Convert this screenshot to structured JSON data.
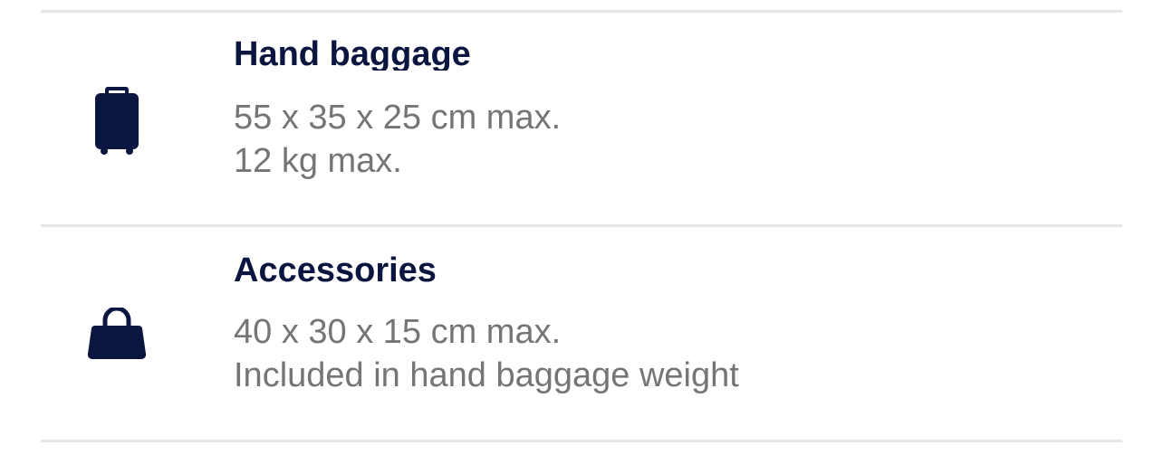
{
  "colors": {
    "title": "#0b1640",
    "detail": "#757575",
    "icon": "#0b1640",
    "divider": "#e6e6e6"
  },
  "items": [
    {
      "icon": "suitcase-icon",
      "title": "Hand baggage",
      "details": [
        "55 x 35 x 25 cm max.",
        "12 kg max."
      ]
    },
    {
      "icon": "handbag-icon",
      "title": "Accessories",
      "details": [
        "40 x 30 x 15 cm max.",
        "Included in hand baggage weight"
      ]
    }
  ]
}
